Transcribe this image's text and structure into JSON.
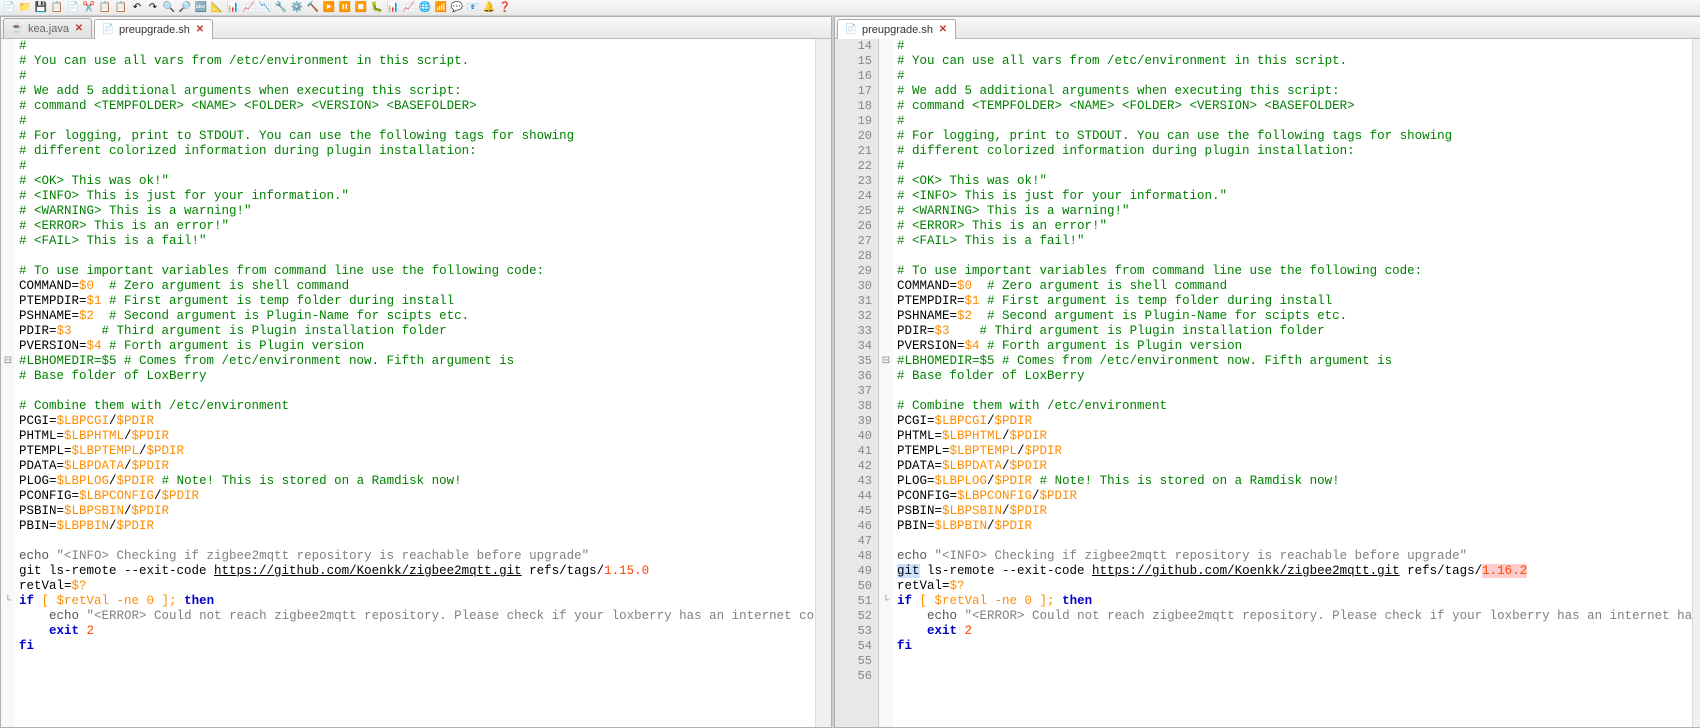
{
  "toolbar_icons": [
    "📄",
    "📁",
    "💾",
    "📋",
    "📄",
    "✂️",
    "📋",
    "📋",
    "↶",
    "↷",
    "🔍",
    "🔎",
    "🔤",
    "📐",
    "📊",
    "📈",
    "📉",
    "🔧",
    "⚙️",
    "🔨",
    "▶️",
    "⏸️",
    "⏹️",
    "🐛",
    "📊",
    "📈",
    "🌐",
    "📶",
    "💬",
    "📧",
    "🔔",
    "❓"
  ],
  "left": {
    "tabs": [
      {
        "label": "kea.java",
        "active": false
      },
      {
        "label": "preupgrade.sh",
        "active": true
      }
    ],
    "diff_version": "1.15.0",
    "error_tail": "Please check if your loxberry has an internet conne"
  },
  "right": {
    "tabs": [
      {
        "label": "preupgrade.sh",
        "active": true
      }
    ],
    "line_start": 14,
    "diff_version": "1.16.2",
    "error_tail": "Please check if your loxberry has an internet ha"
  },
  "code": {
    "header": [
      "#",
      "# You can use all vars from /etc/environment in this script.",
      "#",
      "# We add 5 additional arguments when executing this script:",
      "# command <TEMPFOLDER> <NAME> <FOLDER> <VERSION> <BASEFOLDER>",
      "#",
      "# For logging, print to STDOUT. You can use the following tags for showing",
      "# different colorized information during plugin installation:",
      "#",
      "# <OK> This was ok!\"",
      "# <INFO> This is just for your information.\"",
      "# <WARNING> This is a warning!\"",
      "# <ERROR> This is an error!\"",
      "# <FAIL> This is a fail!\""
    ],
    "vars_header": "# To use important variables from command line use the following code:",
    "vars": [
      {
        "lhs": "COMMAND=",
        "rhs": "$0",
        "pad": "  ",
        "cmt": "# Zero argument is shell command"
      },
      {
        "lhs": "PTEMPDIR=",
        "rhs": "$1",
        "pad": " ",
        "cmt": "# First argument is temp folder during install"
      },
      {
        "lhs": "PSHNAME=",
        "rhs": "$2",
        "pad": "  ",
        "cmt": "# Second argument is Plugin-Name for scipts etc."
      },
      {
        "lhs": "PDIR=",
        "rhs": "$3",
        "pad": "    ",
        "cmt": "# Third argument is Plugin installation folder"
      },
      {
        "lhs": "PVERSION=",
        "rhs": "$4",
        "pad": " ",
        "cmt": "# Forth argument is Plugin version"
      }
    ],
    "lbhomedir": {
      "cmt1": "#LBHOMEDIR=$5 # Comes from /etc/environment now. Fifth argument is",
      "cmt2": "# Base folder of LoxBerry"
    },
    "combine_header": "# Combine them with /etc/environment",
    "paths": [
      {
        "lhs": "PCGI=",
        "a": "$LBPCGI",
        "b": "$PDIR",
        "cmt": ""
      },
      {
        "lhs": "PHTML=",
        "a": "$LBPHTML",
        "b": "$PDIR",
        "cmt": ""
      },
      {
        "lhs": "PTEMPL=",
        "a": "$LBPTEMPL",
        "b": "$PDIR",
        "cmt": ""
      },
      {
        "lhs": "PDATA=",
        "a": "$LBPDATA",
        "b": "$PDIR",
        "cmt": ""
      },
      {
        "lhs": "PLOG=",
        "a": "$LBPLOG",
        "b": "$PDIR",
        "cmt": " # Note! This is stored on a Ramdisk now!"
      },
      {
        "lhs": "PCONFIG=",
        "a": "$LBPCONFIG",
        "b": "$PDIR",
        "cmt": ""
      },
      {
        "lhs": "PSBIN=",
        "a": "$LBPSBIN",
        "b": "$PDIR",
        "cmt": ""
      },
      {
        "lhs": "PBIN=",
        "a": "$LBPBIN",
        "b": "$PDIR",
        "cmt": ""
      }
    ],
    "echo_info": "\"<INFO> Checking if zigbee2mqtt repository is reachable before upgrade\"",
    "git_prefix": "ls-remote --exit-code",
    "git_url": "https://github.com/Koenkk/zigbee2mqtt.git",
    "git_refs": "refs/tags/",
    "retval_line": "retVal=",
    "retval_rhs": "$?",
    "if_line": {
      "kw1": "if",
      "cond": "[ $retVal -ne 0 ]; ",
      "kw2": "then"
    },
    "echo_err": "\"<ERROR> Could not reach zigbee2mqtt repository. ",
    "exit": {
      "kw": "exit",
      "n": "2"
    },
    "fi": "fi"
  }
}
